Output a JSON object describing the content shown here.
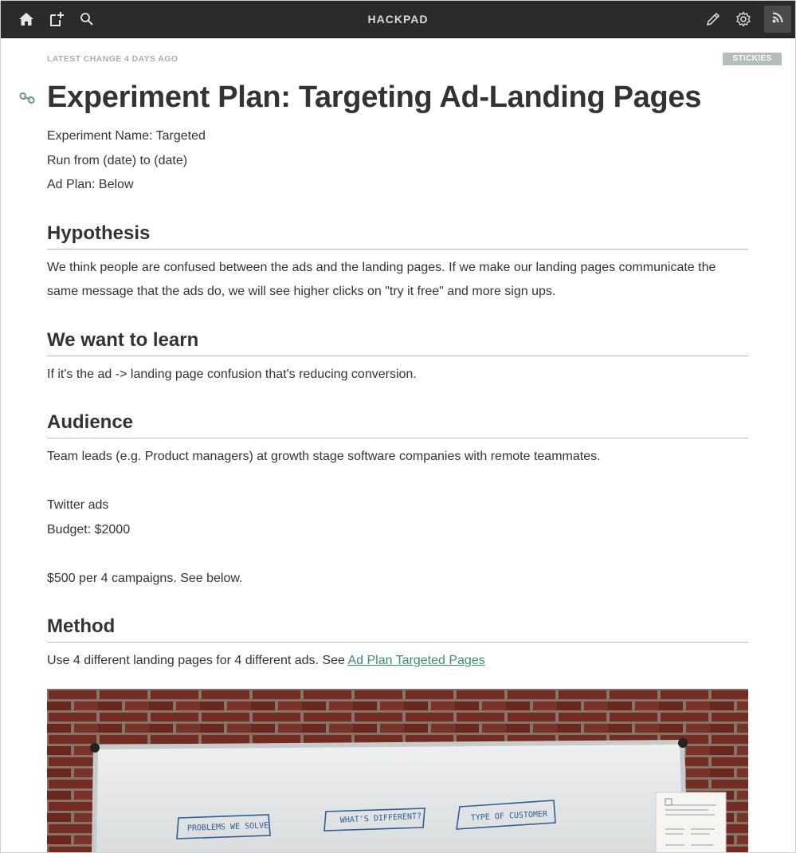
{
  "topbar": {
    "brand": "HACKPAD",
    "icons": [
      "home-icon",
      "new-pad-icon",
      "search-icon",
      "pencil-icon",
      "gear-icon",
      "rss-icon"
    ]
  },
  "meta": {
    "latest_change": "LATEST CHANGE 4 DAYS AGO",
    "stickies_label": "STICKIES"
  },
  "doc": {
    "title": "Experiment Plan: Targeting Ad-Landing Pages",
    "intro": [
      "Experiment Name: Targeted",
      "Run from (date) to (date)",
      "Ad Plan: Below"
    ],
    "hypothesis": {
      "heading": "Hypothesis",
      "text": "We think people are confused between the ads and the landing pages. If we make our landing pages communicate the same message that the ads do, we will see higher clicks on \"try it free\" and more sign ups."
    },
    "learn": {
      "heading": "We want to learn",
      "text": "If it's the ad -> landing page confusion that's reducing conversion."
    },
    "audience": {
      "heading": "Audience",
      "text": "Team leads (e.g. Product managers) at growth stage software companies with remote teammates.",
      "channel": "Twitter ads",
      "budget": "Budget: $2000",
      "campaigns": "$500 per 4 campaigns. See below."
    },
    "method": {
      "heading": "Method",
      "text": "Use 4 different landing pages for 4 different ads. See ",
      "link_text": "Ad Plan Targeted Pages"
    },
    "whiteboard": {
      "notes": [
        "PROBLEMS WE SOLVE",
        "WHAT'S DIFFERENT?",
        "TYPE OF CUSTOMER"
      ]
    }
  }
}
